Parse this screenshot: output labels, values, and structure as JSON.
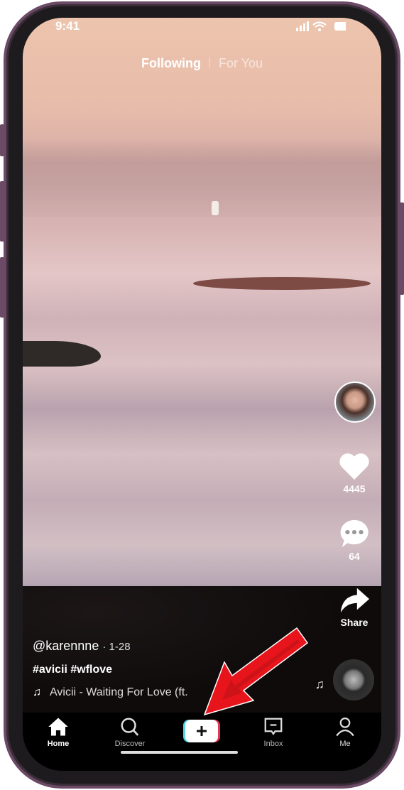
{
  "status": {
    "time": "9:41"
  },
  "top_tabs": [
    {
      "label": "Following",
      "active": true
    },
    {
      "label": "For You",
      "active": false
    }
  ],
  "sidebar": {
    "likes": "4445",
    "comments": "64",
    "share": "Share"
  },
  "post": {
    "username": "@karennne",
    "date": "· 1-28",
    "hashtags": "#avicii #wflove",
    "music": "Avicii - Waiting For Love (ft."
  },
  "bottom_nav": [
    {
      "label": "Home",
      "icon": "home-icon",
      "active": true
    },
    {
      "label": "Discover",
      "icon": "search-icon"
    },
    {
      "label": "",
      "icon": "plus-icon"
    },
    {
      "label": "Inbox",
      "icon": "inbox-icon"
    },
    {
      "label": "Me",
      "icon": "person-icon"
    }
  ],
  "annotation": {
    "color": "#e8141c",
    "points_to": "create-button"
  }
}
